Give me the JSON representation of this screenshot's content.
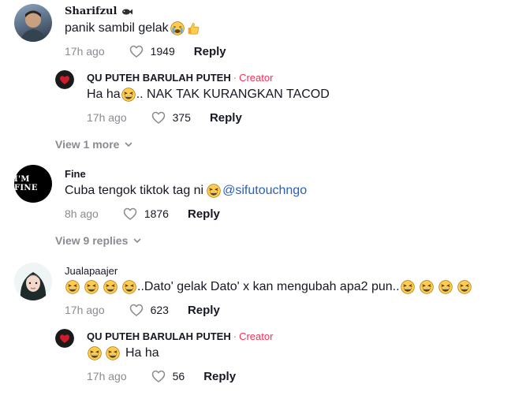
{
  "comments": [
    {
      "username": "Sharifzul",
      "text": "panik sambil gelak",
      "time": "17h ago",
      "likes": "1949",
      "reply": "Reply"
    },
    {
      "username": "QU PUTEH BARULAH PUTEH",
      "badge_sep": "·",
      "badge": "Creator",
      "text_prefix": "Ha ha",
      "text_suffix": ".. NAK TAK KURANGKAN TACOD",
      "time": "17h ago",
      "likes": "375",
      "reply": "Reply"
    },
    {
      "username": "Fine",
      "avatar_text": "I'M FINE",
      "text": "Cuba tengok tiktok tag ni",
      "mention": "@sifutouchngo",
      "time": "8h ago",
      "likes": "1876",
      "reply": "Reply"
    },
    {
      "username": "Jualapaajer",
      "text": "..Dato' gelak Dato' x kan mengubah apa2 pun..",
      "time": "17h ago",
      "likes": "623",
      "reply": "Reply"
    },
    {
      "username": "QU PUTEH BARULAH PUTEH",
      "badge_sep": "·",
      "badge": "Creator",
      "text": "Ha ha",
      "time": "17h ago",
      "likes": "56",
      "reply": "Reply"
    }
  ],
  "view_more_1": "View 1 more",
  "view_more_2": "View 9 replies",
  "icons": {
    "like": "heart-outline-icon",
    "chevron": "chevron-down-icon",
    "laugh": "grinning-squinting-emoji",
    "cry": "crying-face-emoji",
    "thumbs": "thumbs-up-emoji"
  },
  "colors": {
    "creator": "#fe2c55",
    "mention": "#2b5db9",
    "muted": "#8a8b91"
  }
}
